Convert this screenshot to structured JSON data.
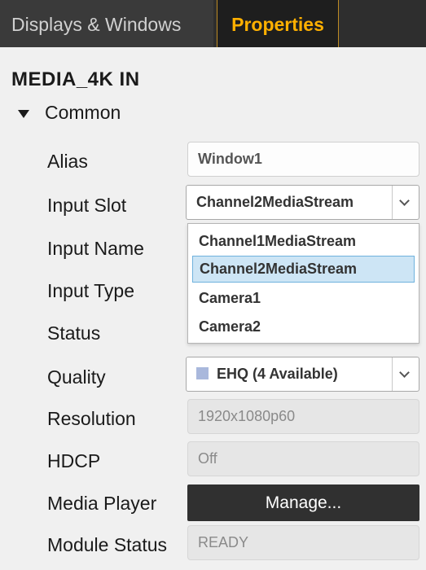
{
  "tabs": [
    {
      "label": "Displays & Windows"
    },
    {
      "label": "Properties"
    }
  ],
  "object_title": "MEDIA_4K IN",
  "section": {
    "label": "Common"
  },
  "fields": {
    "alias": {
      "label": "Alias",
      "value": "Window1"
    },
    "input_slot": {
      "label": "Input Slot",
      "value": "Channel2MediaStream"
    },
    "input_name": {
      "label": "Input Name"
    },
    "input_type": {
      "label": "Input Type"
    },
    "status": {
      "label": "Status"
    },
    "quality": {
      "label": "Quality",
      "value": "EHQ (4 Available)",
      "swatch_color": "#a9b8dc"
    },
    "resolution": {
      "label": "Resolution",
      "value": "1920x1080p60"
    },
    "hdcp": {
      "label": "HDCP",
      "value": "Off"
    },
    "media_player": {
      "label": "Media Player",
      "button_label": "Manage..."
    },
    "module_status": {
      "label": "Module Status",
      "value": "READY"
    }
  },
  "input_slot_options": [
    {
      "label": "Channel1MediaStream",
      "selected": false
    },
    {
      "label": "Channel2MediaStream",
      "selected": true
    },
    {
      "label": "Camera1",
      "selected": false
    },
    {
      "label": "Camera2",
      "selected": false
    }
  ],
  "colors": {
    "active_tab_text": "#ffb000",
    "selection": "#cde5f5",
    "selection_border": "#6fb2dd"
  }
}
